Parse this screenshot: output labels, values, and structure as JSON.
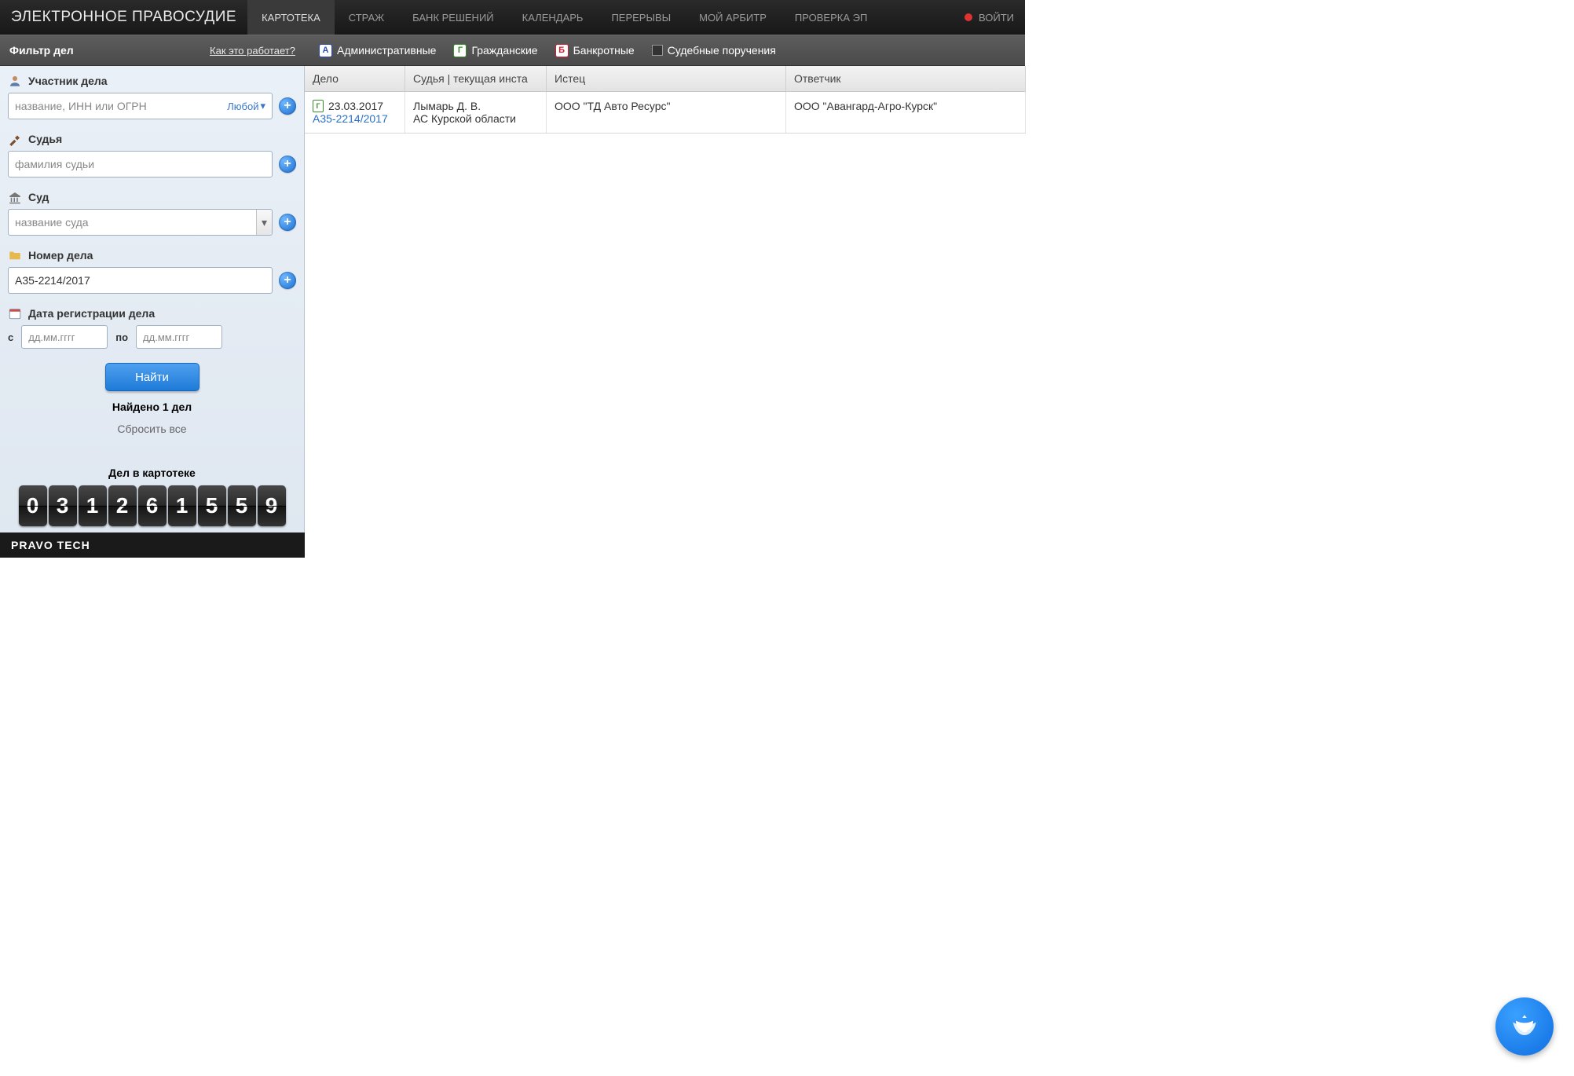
{
  "brand": "ЭЛЕКТРОННОЕ ПРАВОСУДИЕ",
  "nav": {
    "items": [
      "КАРТОТЕКА",
      "СТРАЖ",
      "БАНК РЕШЕНИЙ",
      "КАЛЕНДАРЬ",
      "ПЕРЕРЫВЫ",
      "МОЙ АРБИТР",
      "ПРОВЕРКА ЭП"
    ],
    "login": "ВОЙТИ"
  },
  "filter": {
    "title": "Фильтр дел",
    "how_link": "Как это работает?",
    "participant": {
      "label": "Участник дела",
      "placeholder": "название, ИНН или ОГРН",
      "type_label": "Любой"
    },
    "judge": {
      "label": "Судья",
      "placeholder": "фамилия судьи"
    },
    "court": {
      "label": "Суд",
      "placeholder": "название суда"
    },
    "case_number": {
      "label": "Номер дела",
      "value": "А35-2214/2017"
    },
    "reg_date": {
      "label": "Дата регистрации дела",
      "from_label": "с",
      "to_label": "по",
      "placeholder": "дд.мм.гггг"
    },
    "find_button": "Найти",
    "found": "Найдено 1 дел",
    "reset": "Сбросить все",
    "counter_title": "Дел в картотеке",
    "counter_digits": [
      "0",
      "3",
      "1",
      "2",
      "6",
      "1",
      "5",
      "5",
      "9"
    ]
  },
  "footer_brand": "PRAVO TECH",
  "case_types": {
    "admin": {
      "badge": "А",
      "label": "Административные"
    },
    "civil": {
      "badge": "Г",
      "label": "Гражданские"
    },
    "bankrupt": {
      "badge": "Б",
      "label": "Банкротные"
    },
    "orders": {
      "label": "Судебные поручения"
    }
  },
  "table": {
    "headers": {
      "case": "Дело",
      "judge": "Судья | текущая инста",
      "plaintiff": "Истец",
      "defendant": "Ответчик"
    },
    "rows": [
      {
        "date": "23.03.2017",
        "number": "А35-2214/2017",
        "judge": "Лымарь Д. В.",
        "court": "АС Курской области",
        "plaintiff": "ООО \"ТД Авто Ресурс\"",
        "defendant": "ООО \"Авангард-Агро-Курск\""
      }
    ]
  }
}
